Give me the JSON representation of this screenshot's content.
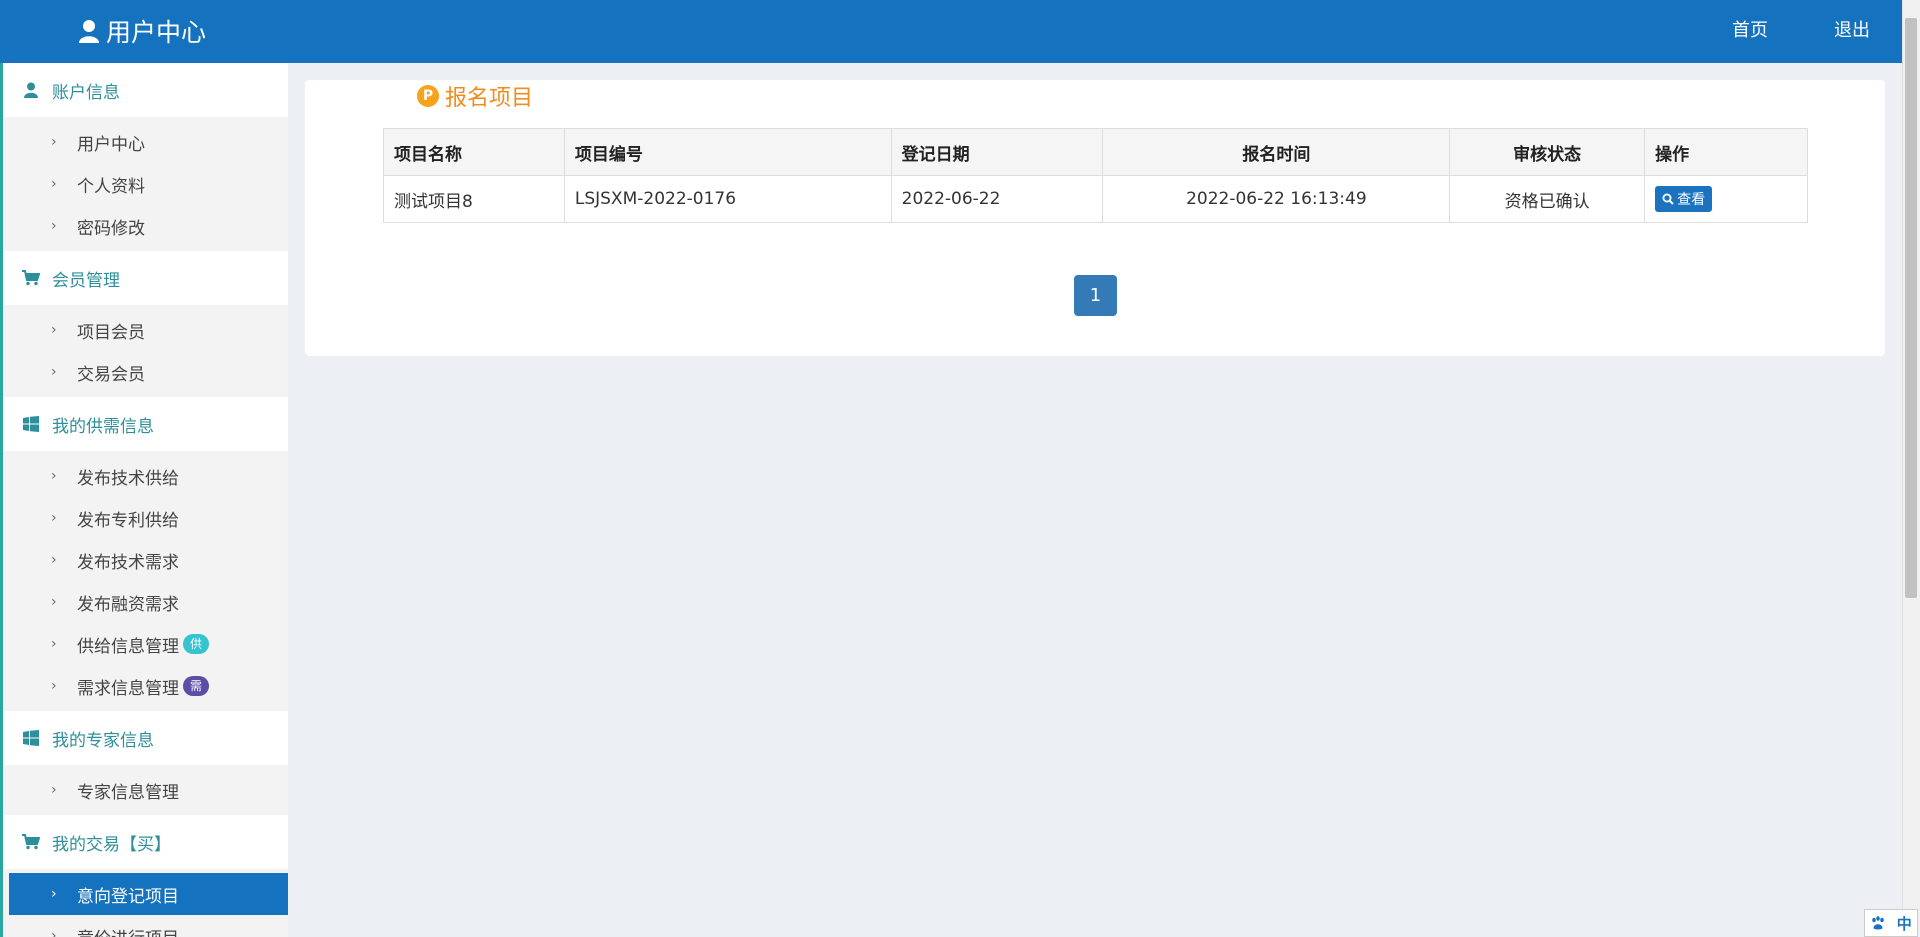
{
  "header": {
    "title": "用户中心",
    "title_icon": "user-icon",
    "nav": {
      "home": "首页",
      "logout": "退出"
    }
  },
  "sidebar": {
    "groups": [
      {
        "label": "账户信息",
        "icon": "user-icon",
        "items": [
          "用户中心",
          "个人资料",
          "密码修改"
        ]
      },
      {
        "label": "会员管理",
        "icon": "cart-icon",
        "items": [
          "项目会员",
          "交易会员"
        ]
      },
      {
        "label": "我的供需信息",
        "icon": "windows-icon",
        "items": [
          "发布技术供给",
          "发布专利供给",
          "发布技术需求",
          "发布融资需求",
          "供给信息管理",
          "需求信息管理"
        ],
        "badges": {
          "supply": "供",
          "demand": "需"
        }
      },
      {
        "label": "我的专家信息",
        "icon": "windows-icon",
        "items": [
          "专家信息管理"
        ]
      },
      {
        "label": "我的交易【买】",
        "icon": "cart-icon",
        "items": [
          "意向登记项目",
          "竞价进行项目"
        ],
        "active": "意向登记项目"
      }
    ]
  },
  "main": {
    "title": "报名项目",
    "title_icon": "p-badge-icon",
    "table": {
      "headers": [
        "项目名称",
        "项目编号",
        "登记日期",
        "报名时间",
        "审核状态",
        "操作"
      ],
      "rows": [
        {
          "name": "测试项目8",
          "code": "LSJSXM-2022-0176",
          "reg_date": "2022-06-22",
          "signup_time": "2022-06-22 16:13:49",
          "status": "资格已确认",
          "action": "查看"
        }
      ]
    },
    "pagination": {
      "current": "1"
    }
  },
  "ime": {
    "label": "中"
  },
  "colors": {
    "header_bg": "#1572be",
    "accent_teal": "#2c8f9b",
    "title_orange": "#f08c1e",
    "page_bg": "#eceff3"
  }
}
